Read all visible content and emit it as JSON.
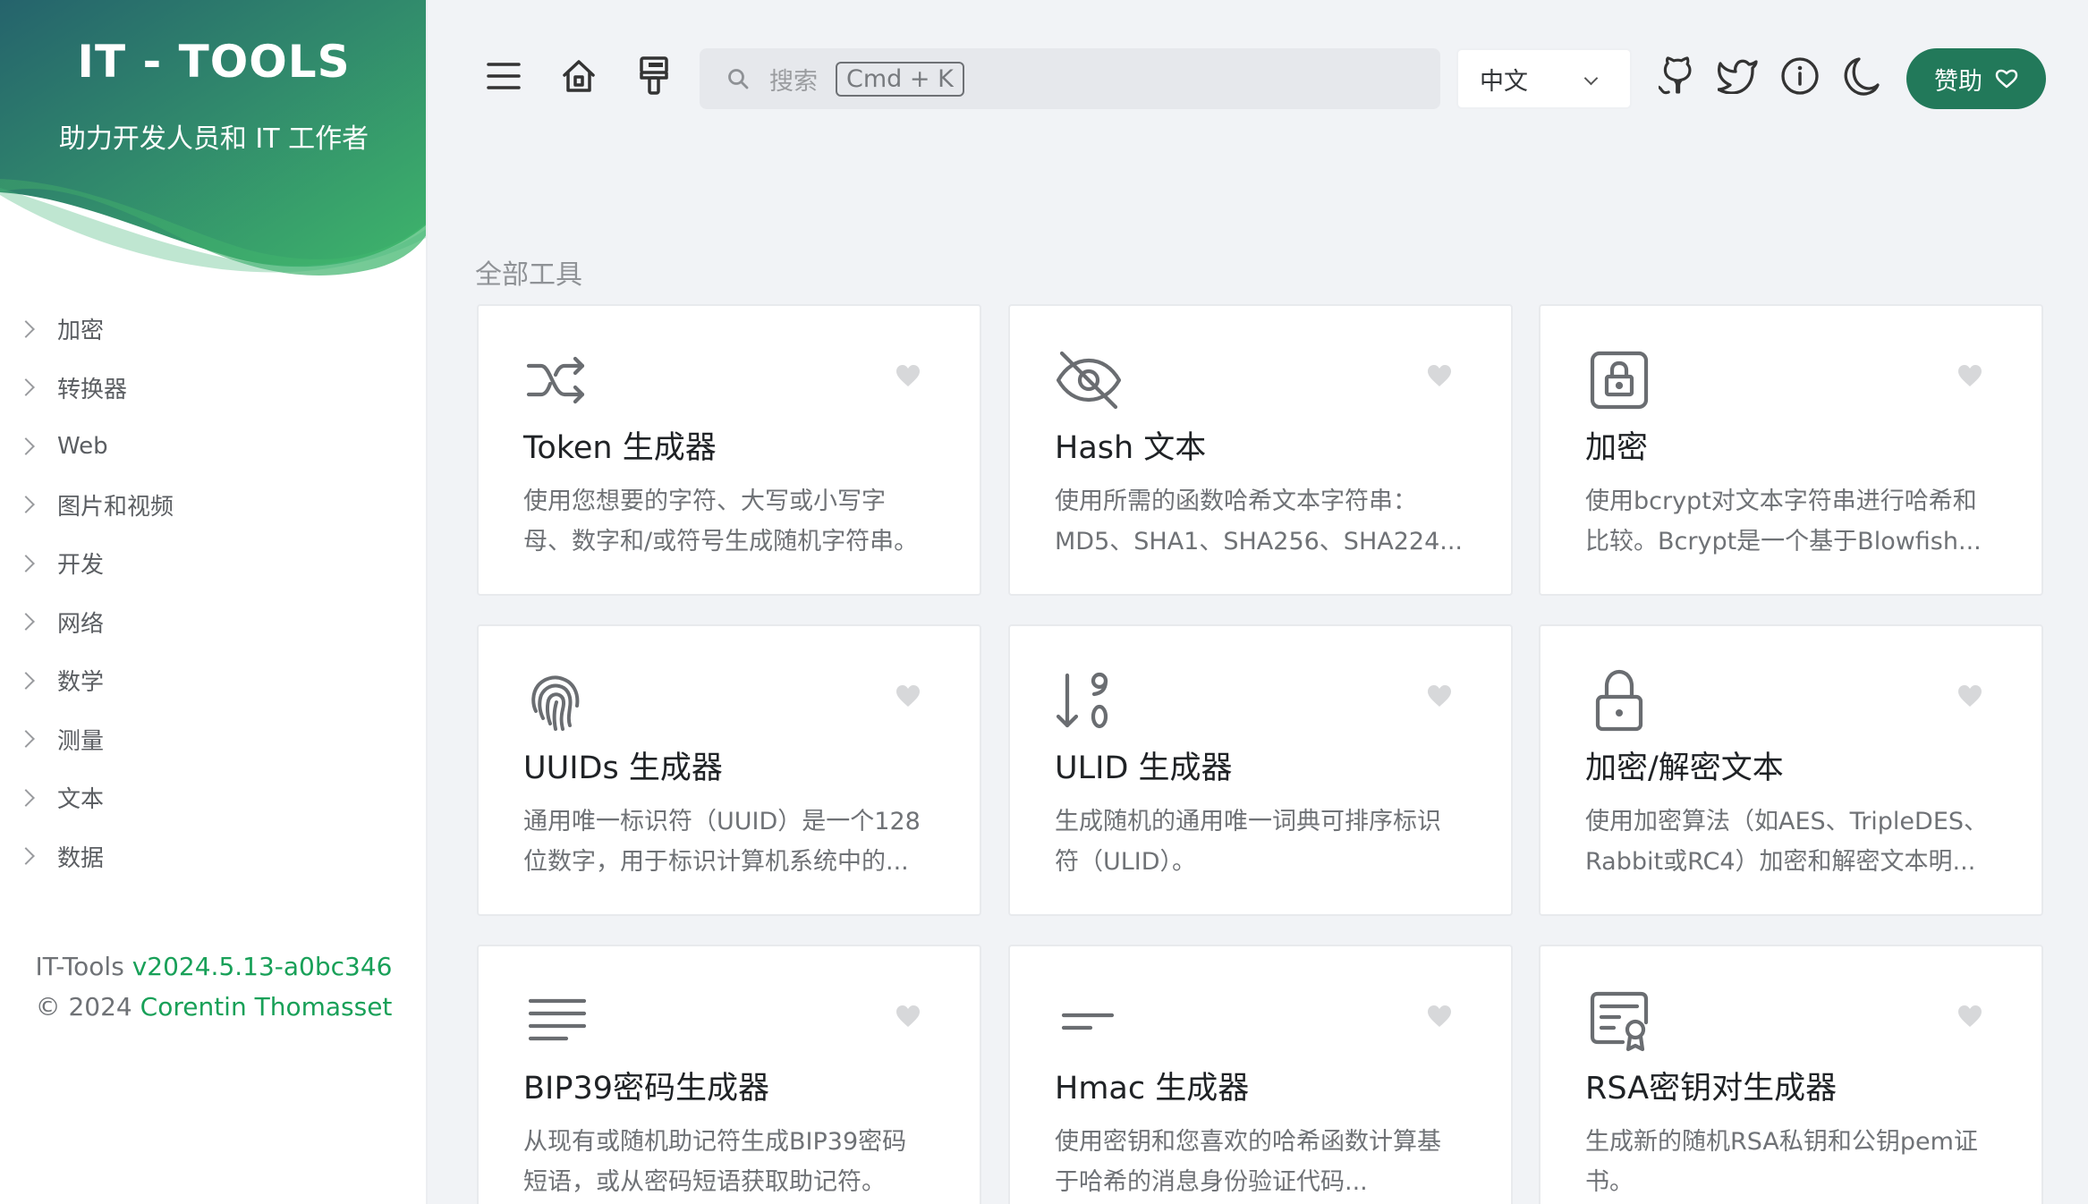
{
  "brand": {
    "title": "IT - TOOLS",
    "subtitle": "助力开发人员和 IT 工作者",
    "gradient_start": "#25636c",
    "gradient_end": "#3eb56b"
  },
  "sidebar": {
    "items": [
      {
        "label": "加密"
      },
      {
        "label": "转换器"
      },
      {
        "label": "Web"
      },
      {
        "label": "图片和视频"
      },
      {
        "label": "开发"
      },
      {
        "label": "网络"
      },
      {
        "label": "数学"
      },
      {
        "label": "测量"
      },
      {
        "label": "文本"
      },
      {
        "label": "数据"
      }
    ]
  },
  "footer": {
    "prefix": "IT-Tools",
    "version": "v2024.5.13-a0bc346",
    "copyright": "© 2024",
    "author": "Corentin Thomasset"
  },
  "header": {
    "menu_icon": "hamburger-icon",
    "home_icon": "home-icon",
    "brush_icon": "paint-brush-icon",
    "search_placeholder": "搜索",
    "search_shortcut": "Cmd + K",
    "language": "中文",
    "github_icon": "github-icon",
    "twitter_icon": "twitter-icon",
    "info_icon": "info-icon",
    "theme_icon": "moon-icon",
    "sponsor_label": "赞助"
  },
  "main": {
    "section_title": "全部工具",
    "accent": "#18a058",
    "tools": [
      {
        "icon": "shuffle-icon",
        "title": "Token 生成器",
        "desc": [
          "使用您想要的字符、大写或小写字",
          "母、数字和/或符号生成随机字符串。"
        ]
      },
      {
        "icon": "eye-off-icon",
        "title": "Hash 文本",
        "desc": [
          "使用所需的函数哈希文本字符串：",
          "MD5、SHA1、SHA256、SHA224..."
        ]
      },
      {
        "icon": "lock-square-icon",
        "title": "加密",
        "desc": [
          "使用bcrypt对文本字符串进行哈希和",
          "比较。Bcrypt是一个基于Blowfish..."
        ]
      },
      {
        "icon": "fingerprint-icon",
        "title": "UUIDs 生成器",
        "desc": [
          "通用唯一标识符（UUID）是一个128",
          "位数字，用于标识计算机系统中的..."
        ]
      },
      {
        "icon": "sort-numeric-icon",
        "title": "ULID 生成器",
        "desc": [
          "生成随机的通用唯一词典可排序标识",
          "符（ULID）。"
        ]
      },
      {
        "icon": "lock-icon",
        "title": "加密/解密文本",
        "desc": [
          "使用加密算法（如AES、TripleDES、",
          "Rabbit或RC4）加密和解密文本明..."
        ]
      },
      {
        "icon": "list-lines-icon",
        "title": "BIP39密码生成器",
        "desc": [
          "从现有或随机助记符生成BIP39密码",
          "短语，或从密码短语获取助记符。"
        ]
      },
      {
        "icon": "short-lines-icon",
        "title": "Hmac 生成器",
        "desc": [
          "使用密钥和您喜欢的哈希函数计算基",
          "于哈希的消息身份验证代码..."
        ]
      },
      {
        "icon": "certificate-icon",
        "title": "RSA密钥对生成器",
        "desc": [
          "生成新的随机RSA私钥和公钥pem证",
          "书。"
        ]
      }
    ]
  }
}
